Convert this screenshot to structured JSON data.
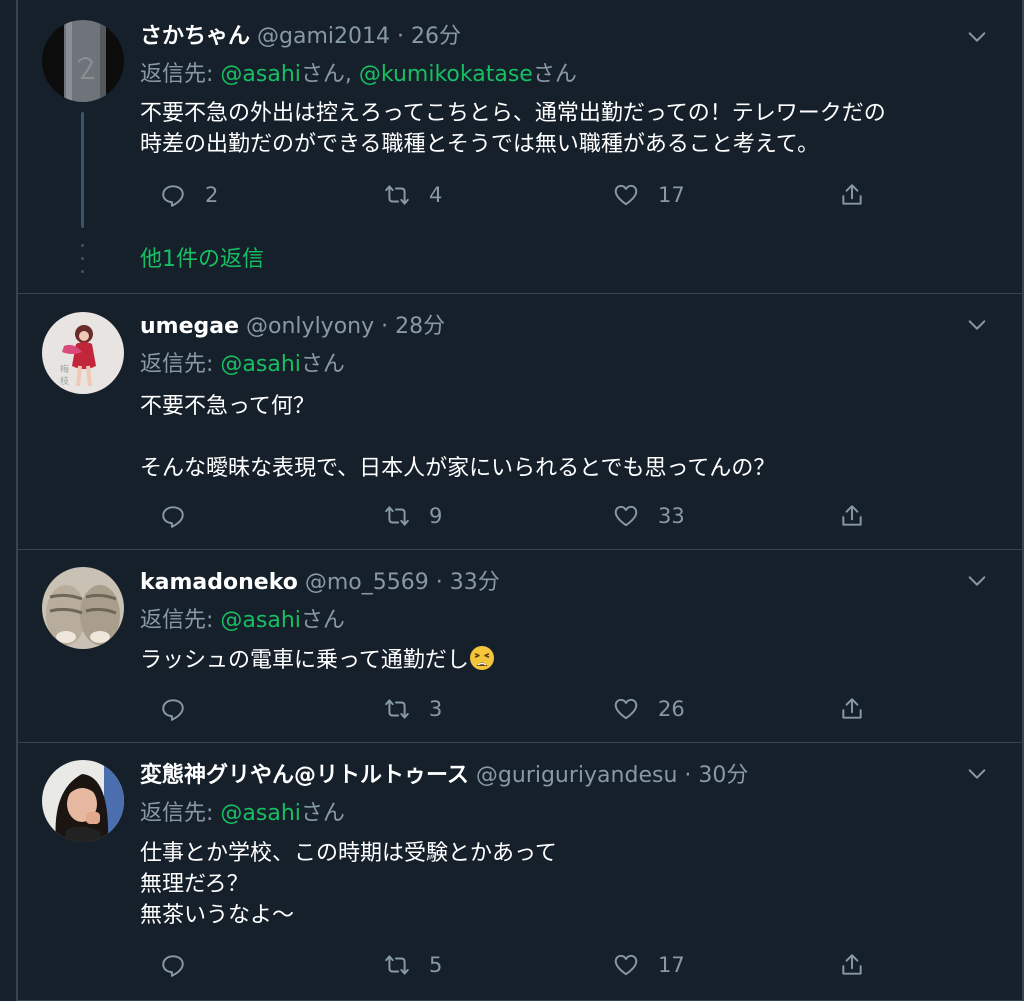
{
  "labels": {
    "reply_to_prefix": "返信先: ",
    "san": "さん",
    "comma": ", ",
    "dot": "·"
  },
  "tweets": [
    {
      "display_name": "さかちゃん",
      "handle": "@gami2014",
      "time": "26分",
      "reply_to": [
        "@asahi",
        "@kumikokatase"
      ],
      "body": [
        "不要不急の外出は控えろってこちとら、通常出勤だっての！テレワークだの",
        "時差の出勤だのができる職種とそうでは無い職種があること考えて。"
      ],
      "counts": {
        "replies": "2",
        "retweets": "4",
        "likes": "17"
      },
      "more_replies": "他1件の返信"
    },
    {
      "display_name": "umegae",
      "handle": "@onlylyony",
      "time": "28分",
      "reply_to": [
        "@asahi"
      ],
      "body": [
        "不要不急って何？",
        "",
        "そんな曖昧な表現で、日本人が家にいられるとでも思ってんの？"
      ],
      "counts": {
        "replies": "",
        "retweets": "9",
        "likes": "33"
      }
    },
    {
      "display_name": "kamadoneko",
      "handle": "@mo_5569",
      "time": "33分",
      "reply_to": [
        "@asahi"
      ],
      "body": [
        "ラッシュの電車に乗って通勤だし"
      ],
      "body_emoji": "weary-face",
      "counts": {
        "replies": "",
        "retweets": "3",
        "likes": "26"
      }
    },
    {
      "display_name": "変態神グリやん@リトルトゥース",
      "handle": "@guriguriyandesu",
      "time": "30分",
      "reply_to": [
        "@asahi"
      ],
      "body": [
        "仕事とか学校、この時期は受験とかあって",
        "無理だろ？",
        "無茶いうなよ〜"
      ],
      "counts": {
        "replies": "",
        "retweets": "5",
        "likes": "17"
      }
    }
  ],
  "colors": {
    "background": "#15202b",
    "divider": "#38444d",
    "secondary_text": "#8899a6",
    "mention": "#17bf63",
    "primary_text": "#ffffff"
  },
  "icons": {
    "reply": "reply-icon",
    "retweet": "retweet-icon",
    "like": "heart-icon",
    "share": "share-icon",
    "caret": "chevron-down-icon"
  }
}
